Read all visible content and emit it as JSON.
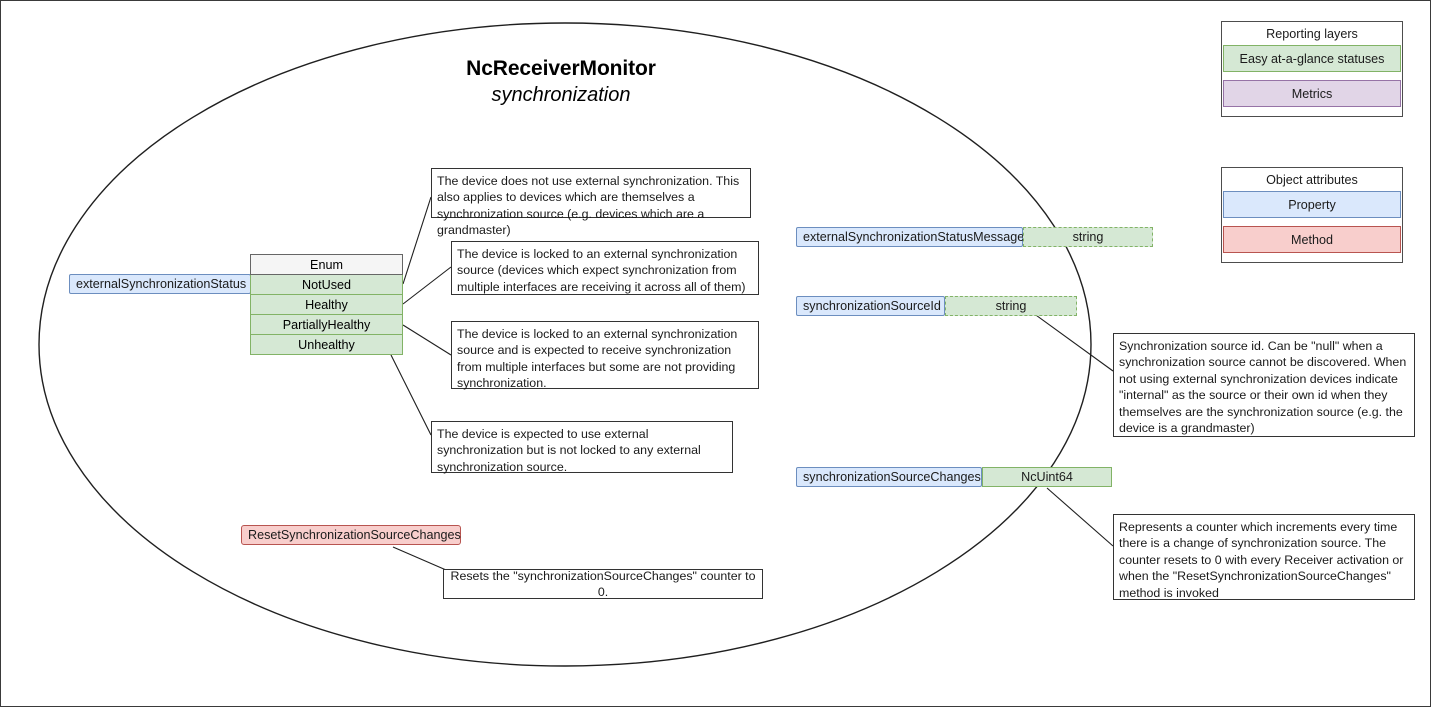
{
  "diagram": {
    "title": "NcReceiverMonitor",
    "subtitle": "synchronization"
  },
  "legends": {
    "reporting_layers": {
      "title": "Reporting layers",
      "items": [
        {
          "label": "Easy at-a-glance statuses",
          "color": "#d5e8d4"
        },
        {
          "label": "Metrics",
          "color": "#e1d5e7"
        }
      ]
    },
    "object_attributes": {
      "title": "Object attributes",
      "items": [
        {
          "label": "Property",
          "color": "#dae8fc"
        },
        {
          "label": "Method",
          "color": "#f8cecc"
        }
      ]
    }
  },
  "status_property": {
    "name": "externalSynchronizationStatus",
    "enum": {
      "header": "Enum",
      "values": [
        "NotUsed",
        "Healthy",
        "PartiallyHealthy",
        "Unhealthy"
      ]
    },
    "descriptions": [
      "The device does not use external synchronization. This also applies to devices which are themselves a synchronization source (e.g. devices which are a grandmaster)",
      "The device is locked to an external synchronization source (devices which expect synchronization from multiple interfaces are receiving it across all of them)",
      "The device is locked to an external synchronization source and is expected to receive synchronization from multiple interfaces but some are not providing synchronization.",
      "The device is expected to use external synchronization but is not locked to any external synchronization source."
    ]
  },
  "properties": [
    {
      "name": "externalSynchronizationStatusMessage",
      "type": "string",
      "type_style": "dashed"
    },
    {
      "name": "synchronizationSourceId",
      "type": "string",
      "type_style": "dashed",
      "description": "Synchronization source id. Can be \"null\" when a synchronization source cannot be discovered. When not using external synchronization devices indicate \"internal\" as the source or their own id when they themselves are the synchronization source (e.g. the device is a grandmaster)"
    },
    {
      "name": "synchronizationSourceChanges",
      "type": "NcUint64",
      "type_style": "solid",
      "description": " Represents a counter which increments every time there is a change of synchronization source. The counter resets to 0 with every Receiver activation or when the \"ResetSynchronizationSourceChanges\" method is invoked"
    }
  ],
  "method": {
    "name": "ResetSynchronizationSourceChanges",
    "description": "Resets the \"synchronizationSourceChanges\" counter to 0."
  }
}
